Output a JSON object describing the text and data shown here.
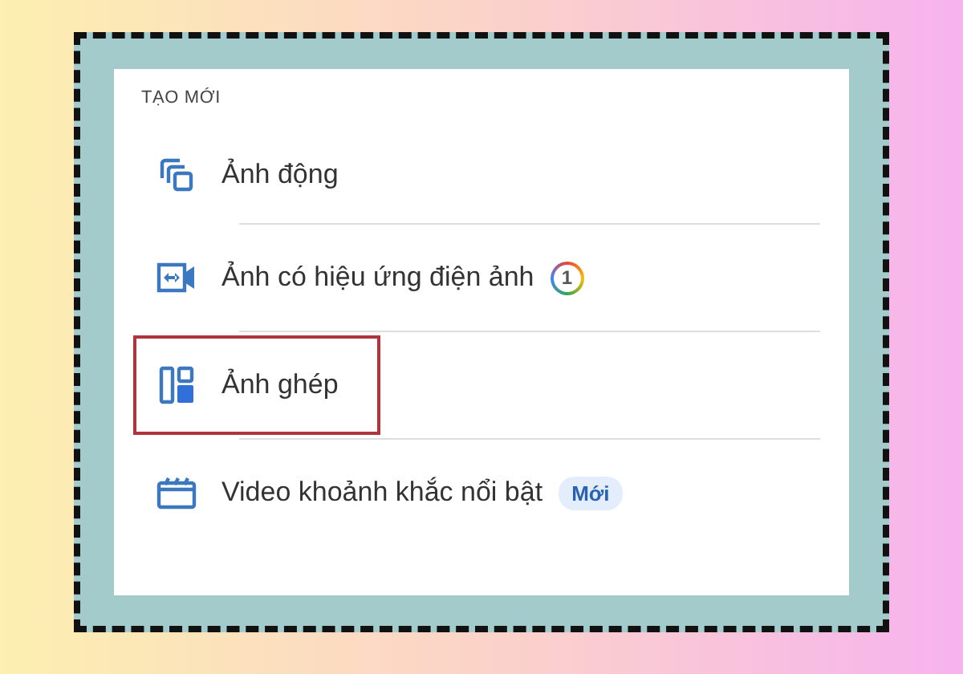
{
  "section_title": "TẠO MỚI",
  "items": [
    {
      "kind": "layers",
      "label": "Ảnh động",
      "highlighted": false
    },
    {
      "kind": "cinematic",
      "label": "Ảnh có hiệu ứng điện ảnh",
      "highlighted": false,
      "badge": {
        "kind": "count",
        "text": "1"
      }
    },
    {
      "kind": "collage",
      "label": "Ảnh ghép",
      "highlighted": true
    },
    {
      "kind": "clapper",
      "label": "Video khoảnh khắc nổi bật",
      "highlighted": false,
      "badge": {
        "kind": "pill",
        "text": "Mới"
      }
    }
  ]
}
